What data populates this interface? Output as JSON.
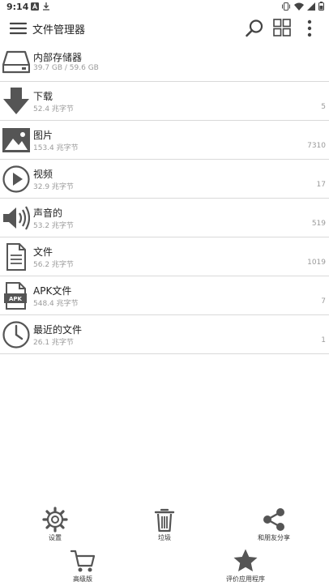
{
  "status_bar": {
    "time": "9:14"
  },
  "app_bar": {
    "title": "文件管理器",
    "icons": [
      "menu-icon",
      "search-icon",
      "grid-view-icon",
      "more-vert-icon"
    ]
  },
  "storage": {
    "title": "内部存储器",
    "usage": "39.7 GB / 59.6 GB"
  },
  "categories": [
    {
      "title": "下载",
      "size": "52.4 兆字节",
      "count": "5",
      "icon": "download-icon"
    },
    {
      "title": "图片",
      "size": "153.4 兆字节",
      "count": "7310",
      "icon": "image-icon"
    },
    {
      "title": "视频",
      "size": "32.9 兆字节",
      "count": "17",
      "icon": "play-icon"
    },
    {
      "title": "声音的",
      "size": "53.2 兆字节",
      "count": "519",
      "icon": "speaker-icon"
    },
    {
      "title": "文件",
      "size": "56.2 兆字节",
      "count": "1019",
      "icon": "document-icon"
    },
    {
      "title": "APK文件",
      "size": "548.4 兆字节",
      "count": "7",
      "icon": "apk-icon",
      "badge": "APK"
    },
    {
      "title": "最近的文件",
      "size": "26.1 兆字节",
      "count": "1",
      "icon": "clock-icon"
    }
  ],
  "actions": {
    "settings": "设置",
    "trash": "垃圾",
    "share": "和朋友分享",
    "premium": "高级版",
    "rate": "评价应用程序"
  },
  "colors": {
    "icon": "#555555",
    "divider": "#d9d9d9",
    "subtext": "#9a9a9a"
  }
}
